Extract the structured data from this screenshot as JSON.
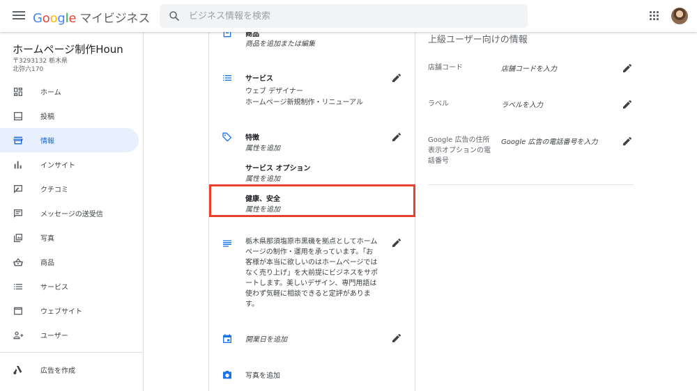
{
  "header": {
    "logo_letters": [
      "G",
      "o",
      "o",
      "g",
      "l",
      "e"
    ],
    "product_name": "マイビジネス",
    "search_placeholder": "ビジネス情報を検索"
  },
  "business": {
    "name": "ホームページ制作Houn",
    "address_line1": "〒3293132 栃木県",
    "address_line2": "北弥六170"
  },
  "sidebar": {
    "items": [
      {
        "label": "ホーム",
        "icon": "dashboard-icon"
      },
      {
        "label": "投稿",
        "icon": "posts-icon"
      },
      {
        "label": "情報",
        "icon": "storefront-icon",
        "active": true
      },
      {
        "label": "インサイト",
        "icon": "insights-bar-icon"
      },
      {
        "label": "クチコミ",
        "icon": "reviews-icon"
      },
      {
        "label": "メッセージの送受信",
        "icon": "message-icon"
      },
      {
        "label": "写真",
        "icon": "photo-library-icon"
      },
      {
        "label": "商品",
        "icon": "basket-icon"
      },
      {
        "label": "サービス",
        "icon": "list-icon"
      },
      {
        "label": "ウェブサイト",
        "icon": "web-icon"
      },
      {
        "label": "ユーザー",
        "icon": "add-person-icon"
      }
    ],
    "ads_item": {
      "label": "広告を作成",
      "icon": "google-ads-icon"
    }
  },
  "info": {
    "products": {
      "title": "商品",
      "value": "商品を追加または編集"
    },
    "services": {
      "title": "サービス",
      "line1": "ウェブ デザイナー",
      "line2": "ホームページ新規制作・リニューアル"
    },
    "attributes": {
      "title": "特徴",
      "value": "属性を追加"
    },
    "service_options": {
      "title": "サービス オプション",
      "value": "属性を追加"
    },
    "health_safety": {
      "title": "健康、安全",
      "value": "属性を追加"
    },
    "description": "栃木県那須塩原市黒磯を拠点としてホームページの制作・運用を承っています。「お客様が本当に欲しいのはホームページではなく売り上げ」を大前提にビジネスをサポートします。美しいデザイン、専門用語は使わず気軽に相談できると定評があります。",
    "opening_date": "開業日を追加",
    "add_photos": "写真を追加"
  },
  "advanced": {
    "title": "上級ユーザー向けの情報",
    "store_code": {
      "label": "店舗コード",
      "value": "店舗コードを入力"
    },
    "labels": {
      "label": "ラベル",
      "value": "ラベルを入力"
    },
    "ad_phone": {
      "label": "Google 広告の住所表示オプションの電話番号",
      "value": "Google 広告の電話番号を入力"
    }
  },
  "colors": {
    "accent_blue": "#1a73e8",
    "active_bg": "#e8f0fe",
    "highlight_red": "#e8412c"
  }
}
